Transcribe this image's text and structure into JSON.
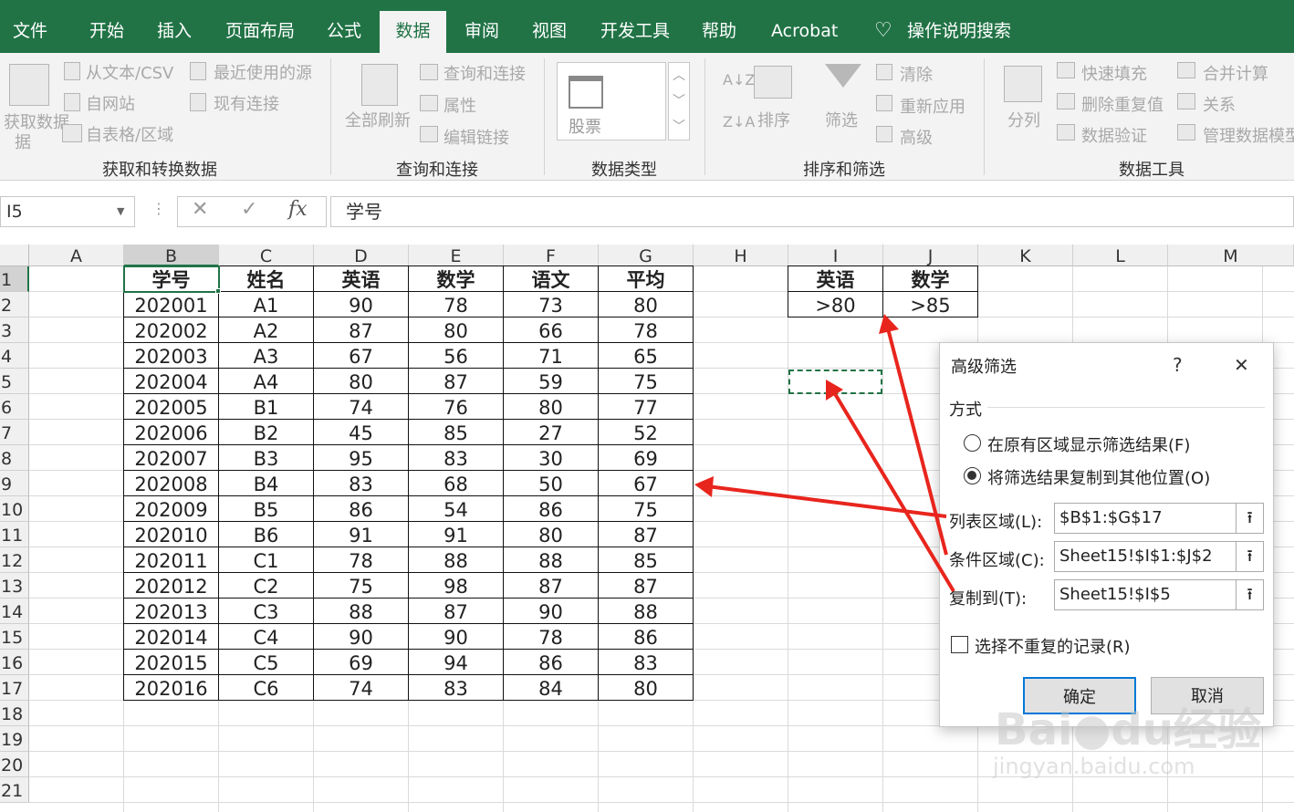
{
  "menu": {
    "file": "文件",
    "home": "开始",
    "insert": "插入",
    "layout": "页面布局",
    "formula": "公式",
    "data": "数据",
    "review": "审阅",
    "view": "视图",
    "dev": "开发工具",
    "help": "帮助",
    "acrobat": "Acrobat",
    "search": "操作说明搜索"
  },
  "ribbon": {
    "get_data": "获取数据",
    "get_data2": "据",
    "from_text": "从文本/CSV",
    "from_web": "自网站",
    "from_table": "自表格/区域",
    "recent": "最近使用的源",
    "existing": "现有连接",
    "refresh_all": "全部刷新",
    "queries": "查询和连接",
    "properties": "属性",
    "edit_links": "编辑链接",
    "stock": "股票",
    "sort": "排序",
    "filter": "筛选",
    "clear": "清除",
    "reapply": "重新应用",
    "advanced": "高级",
    "split": "分列",
    "flash_fill": "快速填充",
    "remove_dup": "删除重复值",
    "validation": "数据验证",
    "consolidate": "合并计算",
    "relations": "关系",
    "data_model": "管理数据模型",
    "group_get": "获取和转换数据",
    "group_query": "查询和连接",
    "group_types": "数据类型",
    "group_sort": "排序和筛选",
    "group_tools": "数据工具"
  },
  "formula_bar": {
    "name_box": "I5",
    "cancel": "✕",
    "enter": "✓",
    "fx": "fx",
    "content": "学号"
  },
  "columns": [
    "A",
    "B",
    "C",
    "D",
    "E",
    "F",
    "G",
    "H",
    "I",
    "J",
    "K",
    "L",
    "M"
  ],
  "rows": [
    "1",
    "2",
    "3",
    "4",
    "5",
    "6",
    "7",
    "8",
    "9",
    "10",
    "11",
    "12",
    "13",
    "14",
    "15",
    "16",
    "17",
    "18",
    "19",
    "20",
    "21"
  ],
  "table": {
    "headers": [
      "学号",
      "姓名",
      "英语",
      "数学",
      "语文",
      "平均"
    ],
    "rows": [
      [
        "202001",
        "A1",
        "90",
        "78",
        "73",
        "80"
      ],
      [
        "202002",
        "A2",
        "87",
        "80",
        "66",
        "78"
      ],
      [
        "202003",
        "A3",
        "67",
        "56",
        "71",
        "65"
      ],
      [
        "202004",
        "A4",
        "80",
        "87",
        "59",
        "75"
      ],
      [
        "202005",
        "B1",
        "74",
        "76",
        "80",
        "77"
      ],
      [
        "202006",
        "B2",
        "45",
        "85",
        "27",
        "52"
      ],
      [
        "202007",
        "B3",
        "95",
        "83",
        "30",
        "69"
      ],
      [
        "202008",
        "B4",
        "83",
        "68",
        "50",
        "67"
      ],
      [
        "202009",
        "B5",
        "86",
        "54",
        "86",
        "75"
      ],
      [
        "202010",
        "B6",
        "91",
        "91",
        "80",
        "87"
      ],
      [
        "202011",
        "C1",
        "78",
        "88",
        "88",
        "85"
      ],
      [
        "202012",
        "C2",
        "75",
        "98",
        "87",
        "87"
      ],
      [
        "202013",
        "C3",
        "88",
        "87",
        "90",
        "88"
      ],
      [
        "202014",
        "C4",
        "90",
        "90",
        "78",
        "86"
      ],
      [
        "202015",
        "C5",
        "69",
        "94",
        "86",
        "83"
      ],
      [
        "202016",
        "C6",
        "74",
        "83",
        "84",
        "80"
      ]
    ]
  },
  "criteria": {
    "headers": [
      "英语",
      "数学"
    ],
    "values": [
      ">80",
      ">85"
    ]
  },
  "dialog": {
    "title": "高级筛选",
    "help": "?",
    "close": "✕",
    "mode_label": "方式",
    "opt_inplace": "在原有区域显示筛选结果(F)",
    "opt_copy": "将筛选结果复制到其他位置(O)",
    "list_label": "列表区域(L):",
    "list_value": "$B$1:$G$17",
    "criteria_label": "条件区域(C):",
    "criteria_value": "Sheet15!$I$1:$J$2",
    "copy_label": "复制到(T):",
    "copy_value": "Sheet15!$I$5",
    "unique_label": "选择不重复的记录(R)",
    "ok": "确定",
    "cancel": "取消",
    "collapse_icon": "⭱"
  },
  "watermark": {
    "logo": "Bai",
    "logo_mid": "du",
    "logo_cn": "经验",
    "url": "jingyan.baidu.com"
  },
  "colors": {
    "excel_green": "#217346",
    "arrow_red": "#e8251d",
    "focus_blue": "#0078d7"
  }
}
